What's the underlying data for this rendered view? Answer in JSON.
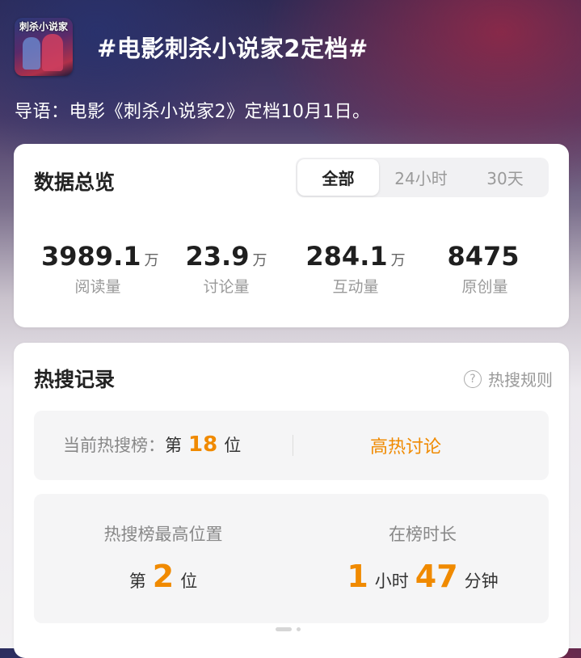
{
  "header": {
    "poster_text": "刺杀小说家",
    "topic_title": "#电影刺杀小说家2定档#"
  },
  "intro": "导语：电影《刺杀小说家2》定档10月1日。",
  "overview": {
    "title": "数据总览",
    "tabs": [
      "全部",
      "24小时",
      "30天"
    ],
    "active_tab": "全部",
    "stats": [
      {
        "value": "3989.1",
        "unit": "万",
        "label": "阅读量"
      },
      {
        "value": "23.9",
        "unit": "万",
        "label": "讨论量"
      },
      {
        "value": "284.1",
        "unit": "万",
        "label": "互动量"
      },
      {
        "value": "8475",
        "unit": "",
        "label": "原创量"
      }
    ]
  },
  "hot_search": {
    "title": "热搜记录",
    "rules_label": "热搜规则",
    "current": {
      "label": "当前热搜榜：",
      "prefix": "第",
      "rank": "18",
      "suffix": "位",
      "tag": "高热讨论"
    },
    "best": {
      "label": "热搜榜最高位置",
      "prefix": "第",
      "rank": "2",
      "suffix": "位"
    },
    "duration": {
      "label": "在榜时长",
      "hours": "1",
      "hours_unit": "小时",
      "minutes": "47",
      "minutes_unit": "分钟"
    }
  },
  "colors": {
    "accent": "#f08a00",
    "card_bg": "#ffffff",
    "inner_box_bg": "#f5f5f6"
  }
}
